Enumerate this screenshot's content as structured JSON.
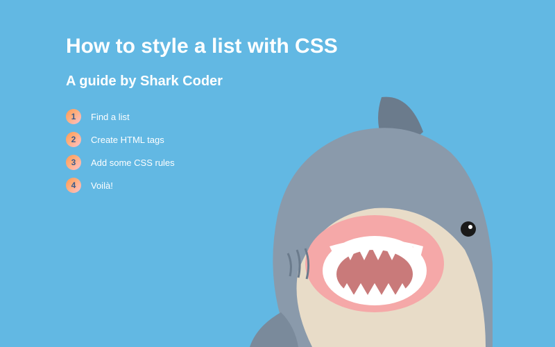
{
  "title": "How to style a list with CSS",
  "subtitle": "A guide by Shark Coder",
  "list": {
    "items": [
      {
        "number": "1",
        "text": "Find a list"
      },
      {
        "number": "2",
        "text": "Create HTML tags"
      },
      {
        "number": "3",
        "text": "Add some CSS rules"
      },
      {
        "number": "4",
        "text": "Voilà!"
      }
    ]
  },
  "colors": {
    "background": "#62b8e3",
    "text": "#ffffff",
    "badge_gradient_start": "#ff9a56",
    "badge_gradient_end": "#ffc0cb",
    "badge_number": "#3a5a8a"
  },
  "decoration": {
    "name": "shark-plush-illustration"
  }
}
